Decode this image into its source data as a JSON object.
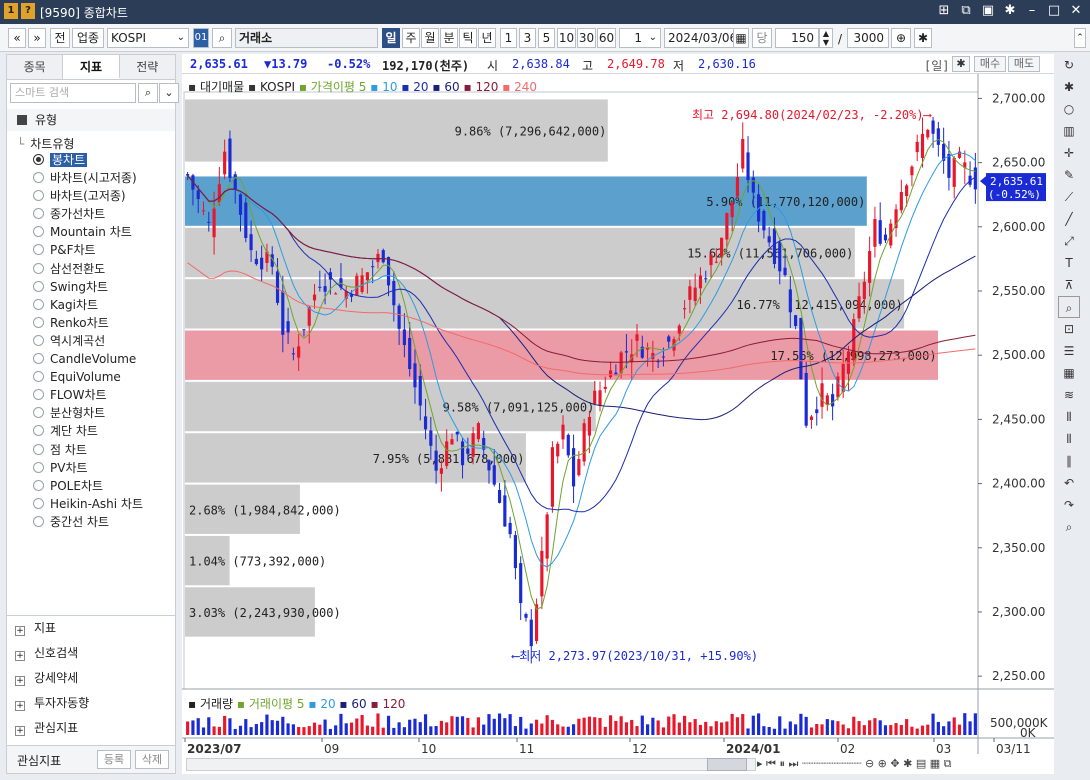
{
  "window": {
    "title": "[9590] 종합차트",
    "badges": [
      "1",
      "?"
    ]
  },
  "toolbar": {
    "prev": "«",
    "next": "»",
    "jeon": "전",
    "upjong": "업종",
    "symbol": "KOSPI",
    "code_icon": "01",
    "market": "거래소",
    "periods": [
      "일",
      "주",
      "월",
      "분",
      "틱",
      "년"
    ],
    "active_period": "일",
    "intervals": [
      "1",
      "3",
      "5",
      "10",
      "30",
      "60"
    ],
    "interval_value": "1",
    "date": "2024/03/06",
    "dang_label": "당",
    "count": "150",
    "slash": "/",
    "total": "3000"
  },
  "left_panel": {
    "tabs": [
      "종목",
      "지표",
      "전략"
    ],
    "active_tab": "지표",
    "search_placeholder": "스마트 검색",
    "type_header": "유형",
    "tree_root": "차트유형",
    "chart_types": [
      "봉차트",
      "바차트(시고저종)",
      "바차트(고저종)",
      "종가선차트",
      "Mountain 차트",
      "P&F차트",
      "삼선전환도",
      "Swing차트",
      "Kagi차트",
      "Renko차트",
      "역시계곡선",
      "CandleVolume",
      "EquiVolume",
      "FLOW차트",
      "분산형차트",
      "계단 차트",
      "점 차트",
      "PV차트",
      "POLE차트",
      "Heikin-Ashi 차트",
      "중간선 차트"
    ],
    "selected_type": "봉차트",
    "sections": [
      "지표",
      "신호검색",
      "강세약세",
      "투자자동향",
      "관심지표"
    ],
    "footer_label": "관심지표",
    "register": "등록",
    "delete": "삭제"
  },
  "quote": {
    "price": "2,635.61",
    "change": "▼13.79",
    "pct": "-0.52%",
    "volume": "192,170(천주)",
    "open_label": "시",
    "open": "2,638.84",
    "high_label": "고",
    "high": "2,649.78",
    "low_label": "저",
    "low": "2,630.16",
    "period_badge": "[일]",
    "buy": "매수",
    "sell": "매도"
  },
  "legend": {
    "main": [
      "대기매물",
      "KOSPI",
      "가격이평 5",
      "10",
      "20",
      "60",
      "120",
      "240"
    ],
    "vol": [
      "거래량",
      "거래이평 5",
      "20",
      "60",
      "120"
    ]
  },
  "colors": {
    "up": "#e8182c",
    "down": "#1a2bd6",
    "ma5": "#6fa52e",
    "ma10": "#2f9be0",
    "ma20": "#1b2db0",
    "ma60": "#1a1f78",
    "ma120": "#8a1b3a",
    "ma240": "#f26a6a",
    "band_blue": "#4a96c8",
    "band_red": "#e8909c",
    "band_gray": "#c9c9c9"
  },
  "chart_data": {
    "type": "candlestick",
    "symbol": "KOSPI",
    "y_axis_ticks": [
      "2,700.00",
      "2,650.00",
      "2,600.00",
      "2,550.00",
      "2,500.00",
      "2,450.00",
      "2,400.00",
      "2,350.00",
      "2,300.00",
      "2,250.00"
    ],
    "ylim": [
      2240,
      2705
    ],
    "x_axis_ticks": [
      "2023/07",
      "09",
      "10",
      "11",
      "12",
      "2024/01",
      "02",
      "03",
      "03/11"
    ],
    "current_value_label": [
      "2,635.61",
      "(-0.52%)"
    ],
    "high_annotation": "최고 2,694.80(2024/02/23, -2.20%)",
    "low_annotation": "최저 2,273.97(2023/10/31, +15.90%)",
    "volume_axis_ticks": [
      "500,000K",
      "0K"
    ],
    "volume_profile": [
      {
        "low": 2650,
        "high": 2700,
        "label": "9.86% (7,296,642,000)",
        "pct": 9.86,
        "kind": "gray"
      },
      {
        "low": 2600,
        "high": 2640,
        "label": "5.90% (11,770,120,000)",
        "pct": 15.9,
        "kind": "blue"
      },
      {
        "low": 2560,
        "high": 2600,
        "label": "15.62% (11,561,706,000)",
        "pct": 15.62,
        "kind": "gray"
      },
      {
        "low": 2520,
        "high": 2560,
        "label": "16.77% (12,415,094,000)",
        "pct": 16.77,
        "kind": "gray"
      },
      {
        "low": 2480,
        "high": 2520,
        "label": "17.56% (12,998,273,000)",
        "pct": 17.56,
        "kind": "red"
      },
      {
        "low": 2440,
        "high": 2480,
        "label": "9.58% (7,091,125,000)",
        "pct": 9.58,
        "kind": "gray"
      },
      {
        "low": 2400,
        "high": 2440,
        "label": "7.95% (5,881,678,000)",
        "pct": 7.95,
        "kind": "gray"
      },
      {
        "low": 2360,
        "high": 2400,
        "label": "2.68% (1,984,842,000)",
        "pct": 2.68,
        "kind": "gray"
      },
      {
        "low": 2320,
        "high": 2360,
        "label": "1.04% (773,392,000)",
        "pct": 1.04,
        "kind": "gray"
      },
      {
        "low": 2280,
        "high": 2320,
        "label": "3.03% (2,243,930,000)",
        "pct": 3.03,
        "kind": "gray"
      }
    ],
    "close_path": [
      [
        0,
        2640
      ],
      [
        4,
        2600
      ],
      [
        7,
        2660
      ],
      [
        12,
        2580
      ],
      [
        16,
        2570
      ],
      [
        18,
        2520
      ],
      [
        20,
        2500
      ],
      [
        25,
        2560
      ],
      [
        30,
        2550
      ],
      [
        33,
        2560
      ],
      [
        37,
        2580
      ],
      [
        40,
        2520
      ],
      [
        44,
        2460
      ],
      [
        47,
        2410
      ],
      [
        50,
        2440
      ],
      [
        52,
        2420
      ],
      [
        55,
        2440
      ],
      [
        58,
        2400
      ],
      [
        61,
        2360
      ],
      [
        63,
        2300
      ],
      [
        65,
        2280
      ],
      [
        67,
        2340
      ],
      [
        69,
        2420
      ],
      [
        71,
        2440
      ],
      [
        73,
        2400
      ],
      [
        76,
        2460
      ],
      [
        79,
        2480
      ],
      [
        82,
        2500
      ],
      [
        85,
        2510
      ],
      [
        88,
        2500
      ],
      [
        91,
        2510
      ],
      [
        94,
        2540
      ],
      [
        97,
        2560
      ],
      [
        100,
        2580
      ],
      [
        103,
        2620
      ],
      [
        105,
        2660
      ],
      [
        107,
        2620
      ],
      [
        109,
        2600
      ],
      [
        111,
        2580
      ],
      [
        113,
        2560
      ],
      [
        115,
        2520
      ],
      [
        117,
        2450
      ],
      [
        120,
        2470
      ],
      [
        122,
        2460
      ],
      [
        124,
        2490
      ],
      [
        126,
        2520
      ],
      [
        128,
        2560
      ],
      [
        130,
        2600
      ],
      [
        132,
        2590
      ],
      [
        134,
        2620
      ],
      [
        136,
        2640
      ],
      [
        138,
        2660
      ],
      [
        140,
        2680
      ],
      [
        142,
        2660
      ],
      [
        144,
        2640
      ],
      [
        146,
        2650
      ],
      [
        148,
        2640
      ],
      [
        149,
        2636
      ]
    ]
  }
}
